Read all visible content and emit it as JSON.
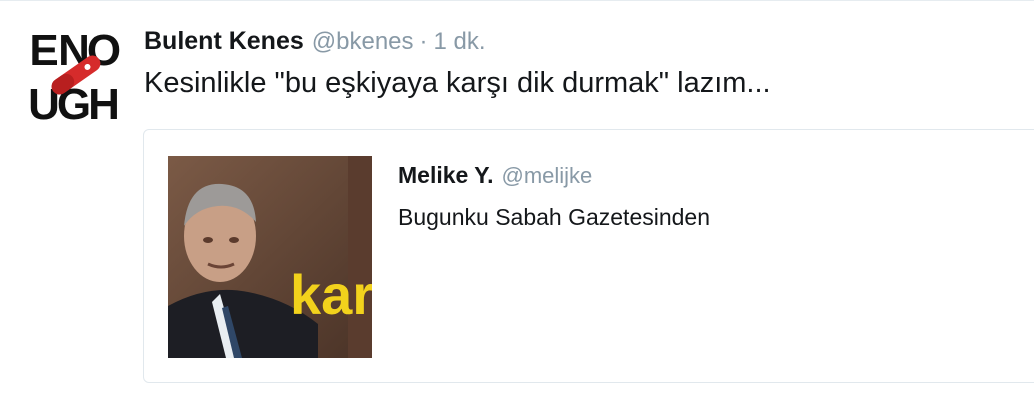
{
  "tweet": {
    "author_name": "Bulent Kenes",
    "author_handle": "@bkenes",
    "separator": "·",
    "time": "1 dk.",
    "text": "Kesinlikle \"bu eşkiyaya karşı dik durmak\" lazım...",
    "avatar_letters": [
      "E",
      "N",
      "O",
      "U",
      "G",
      "H"
    ]
  },
  "quoted_tweet": {
    "author_name": "Melike Y.",
    "author_handle": "@melijke",
    "text": "Bugunku Sabah Gazetesinden",
    "media_caption": "kar"
  },
  "colors": {
    "text": "#14171a",
    "muted": "#8899a6",
    "border": "#e1e8ed",
    "avatar_red": "#d62b2b",
    "headline_yellow": "#f2d21c"
  }
}
